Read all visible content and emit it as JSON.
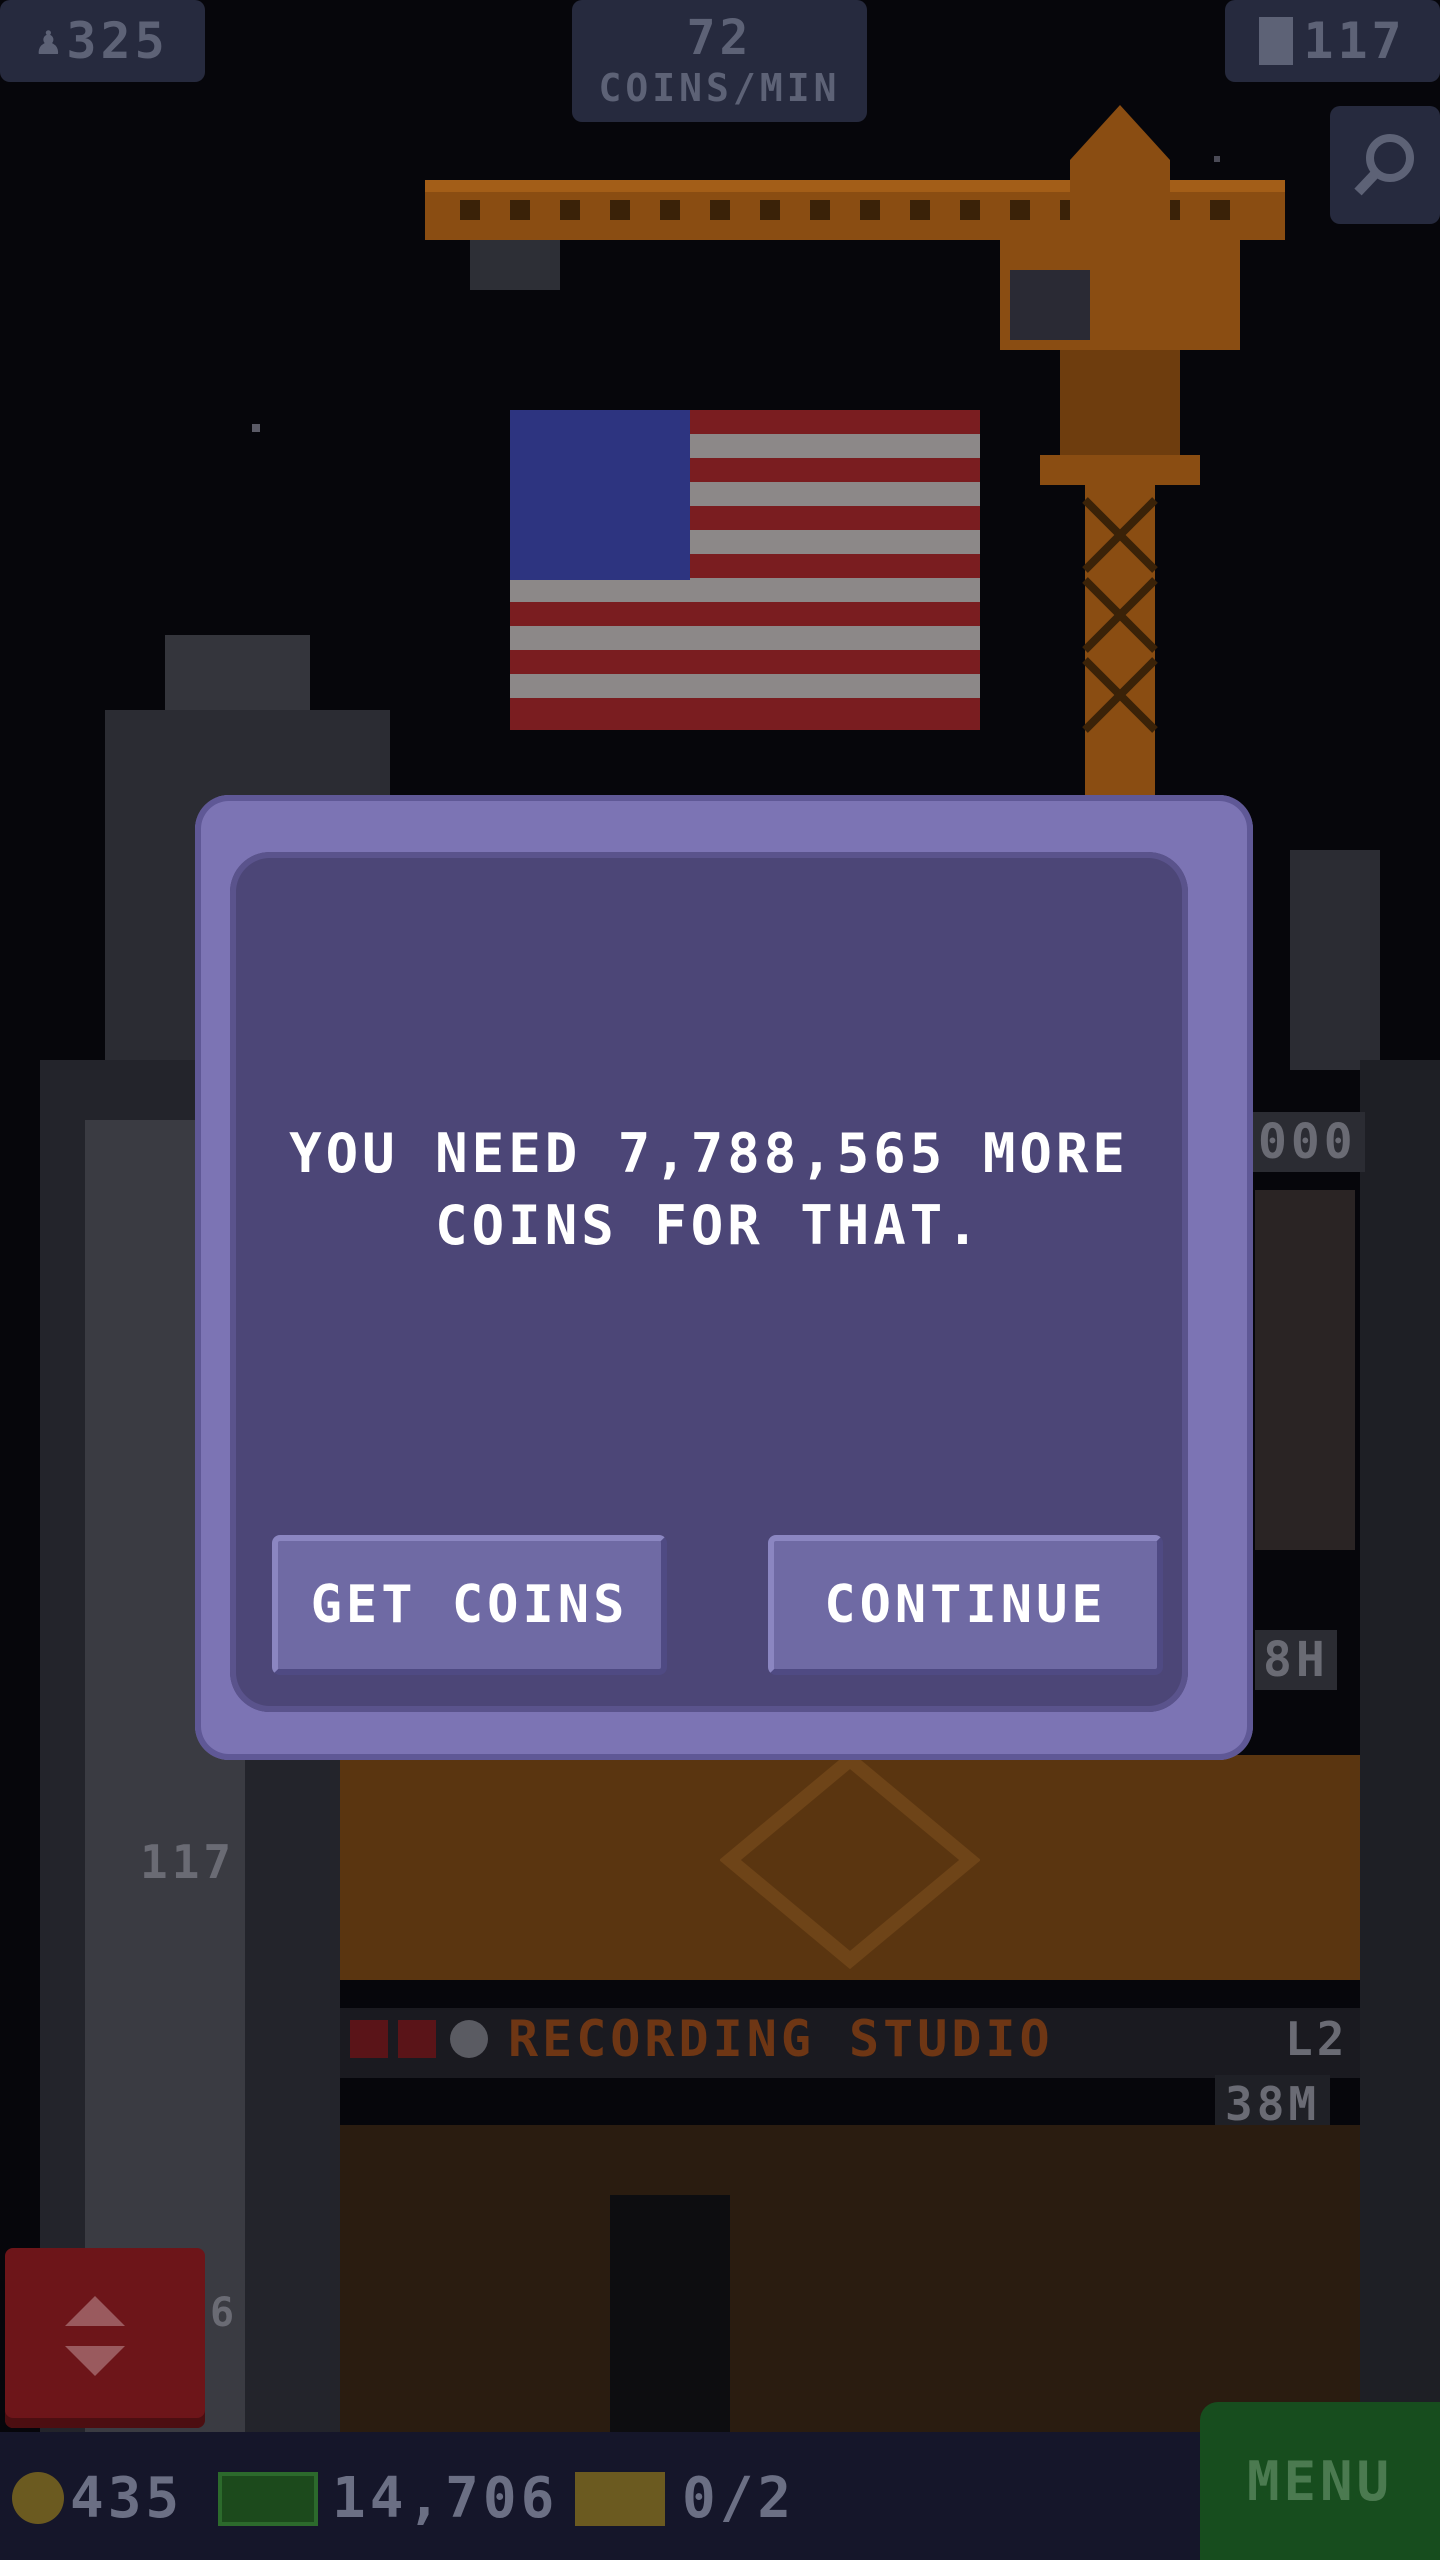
{
  "top": {
    "population": "325",
    "rate_value": "72",
    "rate_unit": "COINS/MIN",
    "floors": "117"
  },
  "tower": {
    "floor_label": "117",
    "floor_stub": "6",
    "stub_time_1": "000",
    "stub_time_2": "8H",
    "store_name": "RECORDING STUDIO",
    "store_level": "L2",
    "store_time": "38M"
  },
  "dialog": {
    "message_line1": "YOU NEED 7,788,565 MORE",
    "message_line2": "COINS FOR THAT.",
    "get_coins_label": "GET COINS",
    "continue_label": "CONTINUE"
  },
  "bottom": {
    "coins": "435",
    "bux": "14,706",
    "tickets": "0/2",
    "menu_label": "MENU"
  },
  "colors": {
    "dialog_outer": "#7c74b4",
    "dialog_inner": "#4c4677",
    "menu_green": "#1f7a2c",
    "elevator_red": "#8e1b22"
  }
}
